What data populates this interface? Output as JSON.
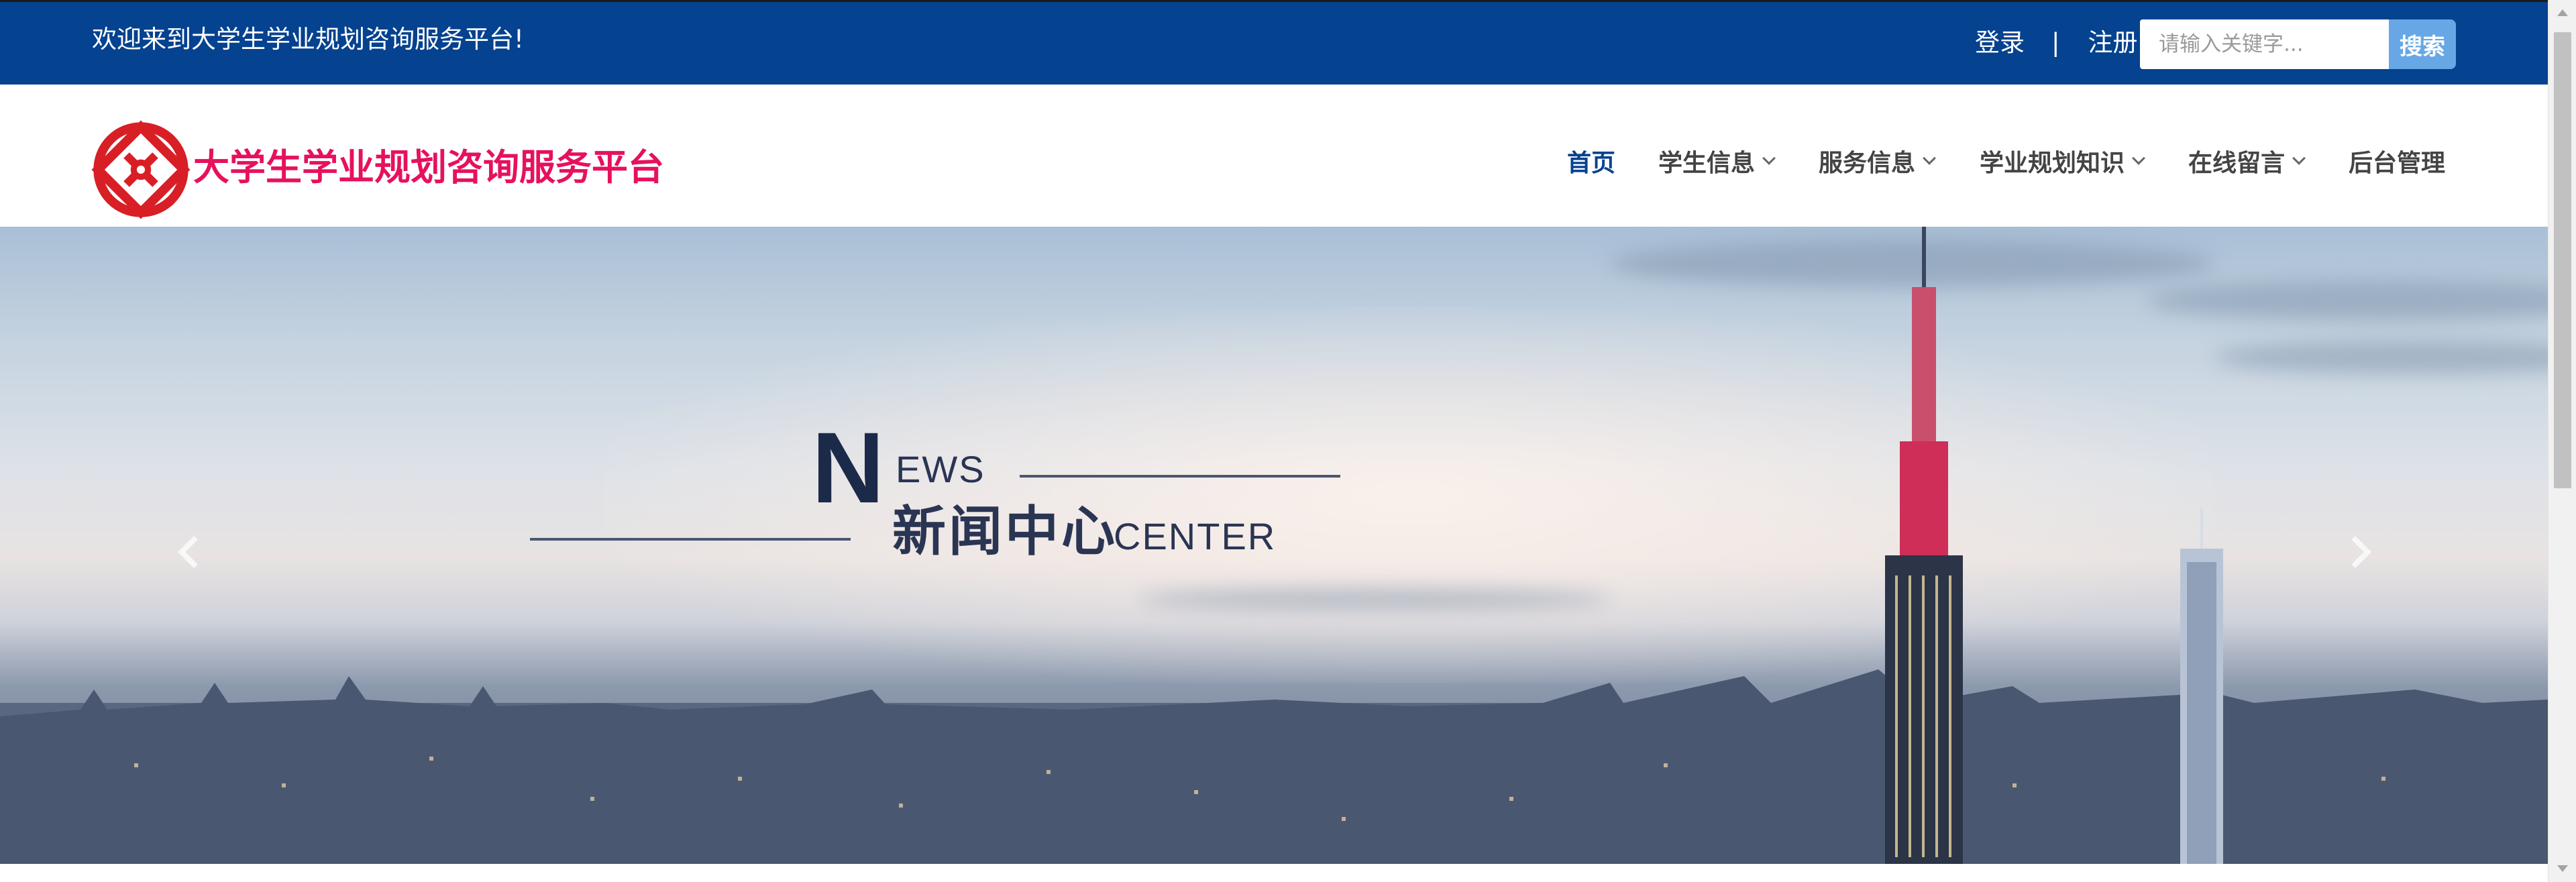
{
  "topbar": {
    "welcome": "欢迎来到大学生学业规划咨询服务平台!",
    "login": "登录",
    "separator": "|",
    "register": "注册",
    "search_placeholder": "请输入关键字...",
    "search_button": "搜索"
  },
  "header": {
    "logo_text": "大学生学业规划咨询服务平台",
    "logo_icon": "red-interlocking-logo-icon"
  },
  "nav": {
    "items": [
      {
        "label": "首页",
        "active": true,
        "dropdown": false
      },
      {
        "label": "学生信息",
        "active": false,
        "dropdown": true
      },
      {
        "label": "服务信息",
        "active": false,
        "dropdown": true
      },
      {
        "label": "学业规划知识",
        "active": false,
        "dropdown": true
      },
      {
        "label": "在线留言",
        "active": false,
        "dropdown": true
      },
      {
        "label": "后台管理",
        "active": false,
        "dropdown": false
      }
    ]
  },
  "banner": {
    "big_letter": "N",
    "ews": "EWS",
    "title_cn": "新闻中心",
    "center": "CENTER",
    "prev_icon": "chevron-left-icon",
    "next_icon": "chevron-right-icon"
  },
  "colors": {
    "topbar_bg": "#05428f",
    "brand_red": "#e6115e",
    "nav_active": "#05428f",
    "search_button": "#67a7e6"
  }
}
